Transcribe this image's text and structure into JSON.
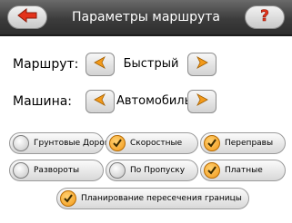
{
  "header": {
    "title": "Параметры маршрута",
    "back_icon": "back-arrow-icon",
    "help_icon": "question-mark-icon"
  },
  "route": {
    "label": "Маршрут:",
    "value": "Быстрый"
  },
  "vehicle": {
    "label": "Машина:",
    "value": "Автомобиль"
  },
  "options": [
    {
      "label": "Грунтовые Дороги",
      "checked": false
    },
    {
      "label": "Скоростные",
      "checked": true
    },
    {
      "label": "Переправы",
      "checked": true
    },
    {
      "label": "Развороты",
      "checked": false
    },
    {
      "label": "По Пропуску",
      "checked": false
    },
    {
      "label": "Платные",
      "checked": true
    },
    {
      "label": "Планирование пересечения границы",
      "checked": true
    }
  ],
  "colors": {
    "accent": "#f39a1a",
    "header": "#3c3c3c"
  }
}
